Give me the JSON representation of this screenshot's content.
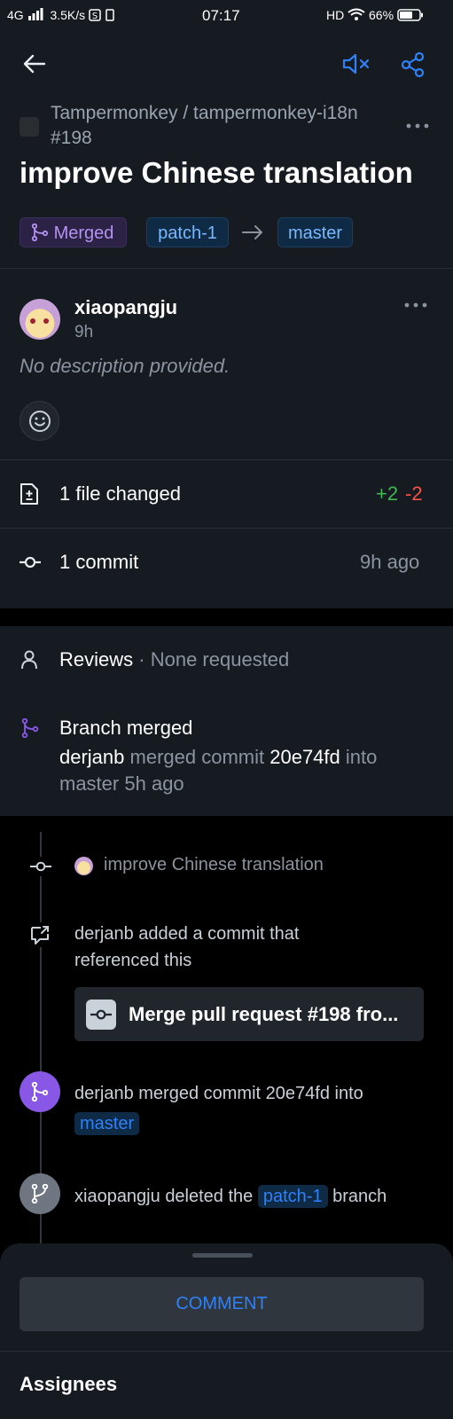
{
  "status_bar": {
    "network": "4G",
    "speed": "3.5K/s",
    "time": "07:17",
    "hd": "HD",
    "battery": "66%"
  },
  "header": {
    "repo": "Tampermonkey / tampermonkey-i18n",
    "number": "#198",
    "title": "improve Chinese translation",
    "state_label": "Merged",
    "head_branch": "patch-1",
    "base_branch": "master"
  },
  "body": {
    "author": "xiaopangju",
    "time": "9h",
    "description": "No description provided."
  },
  "files": {
    "label": "1 file changed",
    "additions": "+2",
    "deletions": "-2"
  },
  "commits": {
    "label": "1 commit",
    "time": "9h ago"
  },
  "reviews": {
    "label": "Reviews",
    "sep": "·",
    "status": "None requested"
  },
  "merged_box": {
    "title": "Branch merged",
    "actor": "derjanb",
    "text1": "merged commit",
    "commit": "20e74fd",
    "text2": "into",
    "branch": "master",
    "time": "5h ago"
  },
  "timeline": {
    "commit_title": "improve Chinese translation",
    "ref_line1": "derjanb added a commit that",
    "ref_line2": "referenced this",
    "ref_commit": "Merge pull request #198 fro...",
    "merged_text": "derjanb merged commit 20e74fd into",
    "merged_branch": "master",
    "deleted_actor": "xiaopangju",
    "deleted_text1": "deleted the",
    "deleted_branch": "patch-1",
    "deleted_text2": "branch"
  },
  "bottom_sheet": {
    "comment_button": "COMMENT",
    "assignees": "Assignees"
  },
  "colors": {
    "background": "#000000",
    "surface": "#161b22",
    "accent_blue": "#2f81f7",
    "merged_purple": "#8957e5",
    "additions_green": "#3fb950",
    "deletions_red": "#f85149"
  }
}
